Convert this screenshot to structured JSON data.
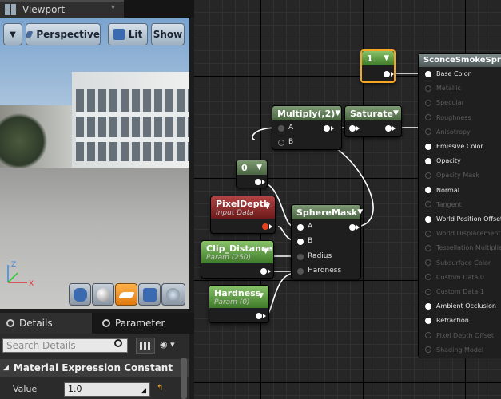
{
  "viewport_tab": {
    "title": "Viewport",
    "close": "▾"
  },
  "viewport": {
    "perspective_label": "Perspective",
    "lit_label": "Lit",
    "show_label": "Show",
    "menu_glyph": "▼",
    "gizmo_z": "Z",
    "gizmo_x": "X"
  },
  "details_panel": {
    "tab_details": "Details",
    "tab_parameters": "Parameter",
    "search_placeholder": "Search Details",
    "section_title": "Material Expression Constant",
    "value_label": "Value",
    "value": "1.0"
  },
  "nodes": {
    "constant_1": "1",
    "constant_0": "0",
    "multiply": {
      "title": "Multiply(,2)",
      "pin_a": "A",
      "pin_b": "B"
    },
    "saturate": "Saturate",
    "pixeldepth": {
      "title": "PixelDepth",
      "subtitle": "Input Data"
    },
    "clip_distance": {
      "title": "Clip_Distance",
      "subtitle": "Param (250)"
    },
    "hardness_param": {
      "title": "Hardness",
      "subtitle": "Param (0)"
    },
    "spheremask": {
      "title": "SphereMask",
      "pin_a": "A",
      "pin_b": "B",
      "pin_radius": "Radius",
      "pin_hardness": "Hardness"
    }
  },
  "material_node": {
    "title": "SconceSmokeSprite_m",
    "inputs": [
      {
        "label": "Base Color",
        "active": true
      },
      {
        "label": "Metallic",
        "active": false
      },
      {
        "label": "Specular",
        "active": false
      },
      {
        "label": "Roughness",
        "active": false
      },
      {
        "label": "Anisotropy",
        "active": false
      },
      {
        "label": "Emissive Color",
        "active": true
      },
      {
        "label": "Opacity",
        "active": true
      },
      {
        "label": "Opacity Mask",
        "active": false
      },
      {
        "label": "Normal",
        "active": true
      },
      {
        "label": "Tangent",
        "active": false
      },
      {
        "label": "World Position Offset",
        "active": true
      },
      {
        "label": "World Displacement",
        "active": false
      },
      {
        "label": "Tessellation Multiplier",
        "active": false
      },
      {
        "label": "Subsurface Color",
        "active": false
      },
      {
        "label": "Custom Data 0",
        "active": false
      },
      {
        "label": "Custom Data 1",
        "active": false
      },
      {
        "label": "Ambient Occlusion",
        "active": true
      },
      {
        "label": "Refraction",
        "active": true
      },
      {
        "label": "Pixel Depth Offset",
        "active": false
      },
      {
        "label": "Shading Model",
        "active": false
      }
    ]
  },
  "colors": {
    "accent": "#f5a623",
    "node_green": "#4a6442",
    "node_red": "#6c1a1a"
  }
}
